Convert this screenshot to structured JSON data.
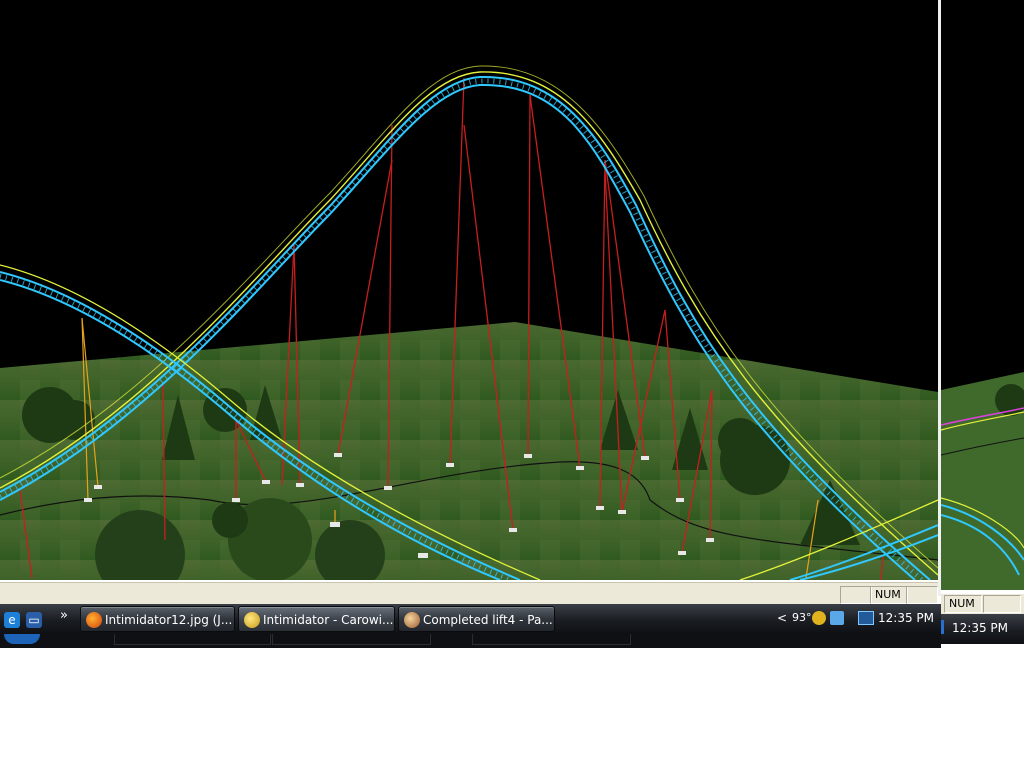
{
  "window": {
    "title": "Intimidator - Carowinds coaster track view"
  },
  "status_bar": {
    "panes": [
      "",
      "NUM",
      ""
    ],
    "right_pane": "NUM"
  },
  "taskbar": {
    "quick_launch": [
      "internet-explorer-icon",
      "show-desktop-icon"
    ],
    "overflow_label": "»",
    "buttons": [
      {
        "label": "Intimidator12.jpg (J...",
        "icon": "firefox-icon",
        "active": false
      },
      {
        "label": "Intimidator - Carowi...",
        "icon": "coaster-app-icon",
        "active": true
      },
      {
        "label": "Completed lift4 - Pa...",
        "icon": "paint-icon",
        "active": false
      }
    ],
    "tray": {
      "chevron": "<",
      "temperature": "93°",
      "icons": [
        "network-icon",
        "dropbox-icon",
        "monitor-icon"
      ],
      "clock": "12:35 PM"
    },
    "right_clock": "12:35 PM"
  },
  "colors": {
    "sky": "#000000",
    "grass": "#3f6a2c",
    "rail_yellow": "#e2f23a",
    "rail_cyan": "#2fc8ff",
    "supports": "#c81e1e",
    "ground_track": "#111111"
  }
}
